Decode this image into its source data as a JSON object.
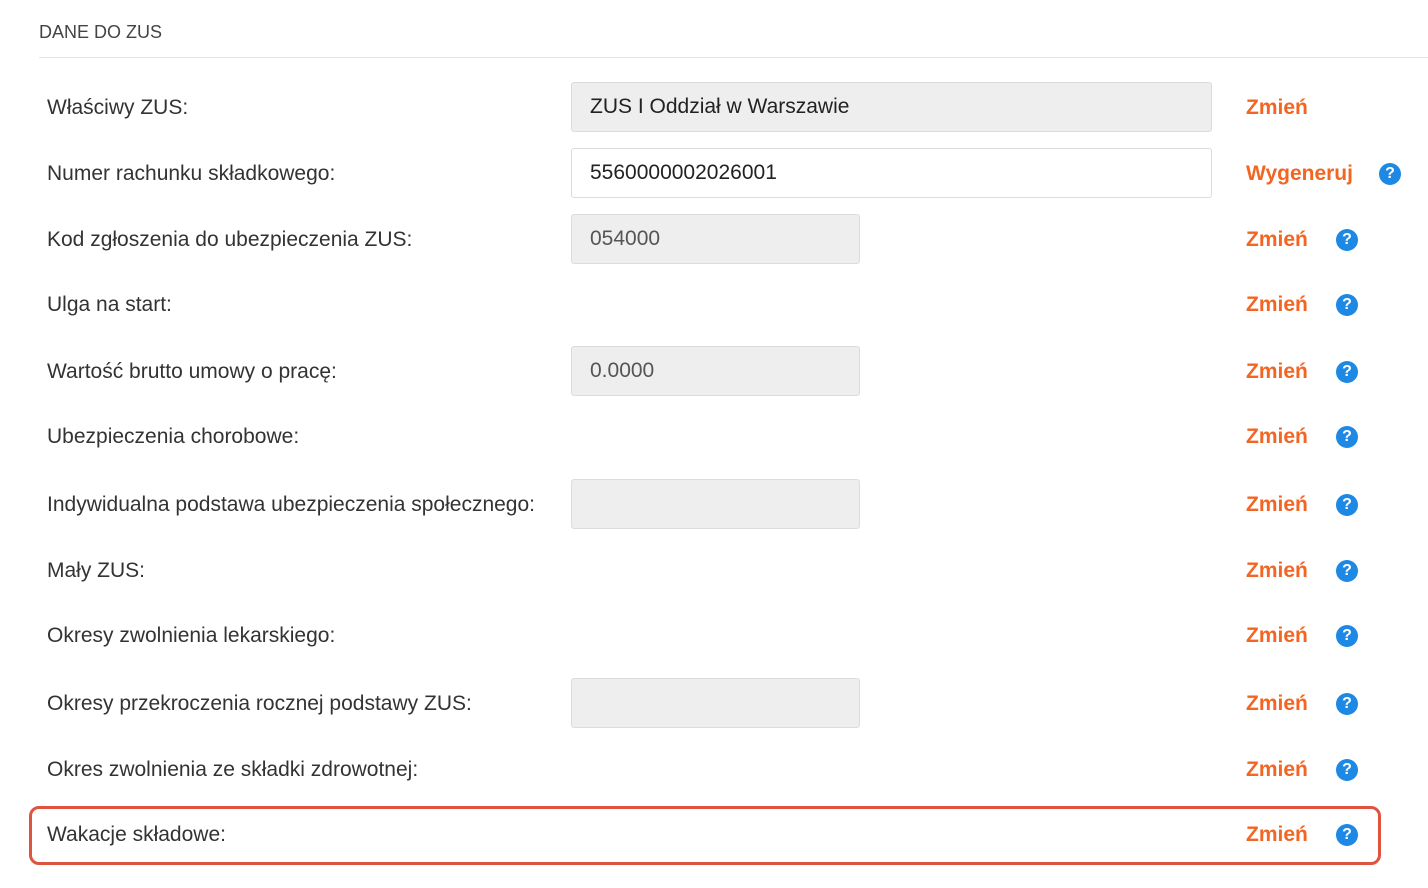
{
  "section": {
    "title": "DANE DO ZUS"
  },
  "colors": {
    "action": "#f26522",
    "help": "#1e88e5",
    "highlight": "#e0533f"
  },
  "rows": [
    {
      "label": "Właściwy ZUS:",
      "value": "ZUS I Oddział w Warszawie",
      "action": "Zmień",
      "help_icon": "none"
    },
    {
      "label": "Numer rachunku składkowego:",
      "value": "5560000002026001",
      "action": "Wygeneruj",
      "help_icon": "question-circle-icon"
    },
    {
      "label": "Kod zgłoszenia do ubezpieczenia ZUS:",
      "value": "054000",
      "action": "Zmień",
      "help_icon": "question-circle-icon"
    },
    {
      "label": "Ulga na start:",
      "action": "Zmień",
      "help_icon": "question-circle-icon"
    },
    {
      "label": "Wartość brutto umowy o pracę:",
      "value": "0.0000",
      "action": "Zmień",
      "help_icon": "question-circle-icon"
    },
    {
      "label": "Ubezpieczenia chorobowe:",
      "action": "Zmień",
      "help_icon": "question-circle-icon"
    },
    {
      "label": "Indywidualna podstawa ubezpieczenia społecznego:",
      "value": "",
      "action": "Zmień",
      "help_icon": "question-circle-icon"
    },
    {
      "label": "Mały ZUS:",
      "action": "Zmień",
      "help_icon": "question-circle-icon"
    },
    {
      "label": "Okresy zwolnienia lekarskiego:",
      "action": "Zmień",
      "help_icon": "question-circle-icon"
    },
    {
      "label": "Okresy przekroczenia rocznej podstawy ZUS:",
      "value": "",
      "action": "Zmień",
      "help_icon": "question-circle-icon"
    },
    {
      "label": "Okres zwolnienia ze składki zdrowotnej:",
      "action": "Zmień",
      "help_icon": "question-circle-icon"
    },
    {
      "label": "Wakacje składowe:",
      "action": "Zmień",
      "help_icon": "question-circle-icon",
      "highlighted": true
    }
  ],
  "help_glyph": "?"
}
